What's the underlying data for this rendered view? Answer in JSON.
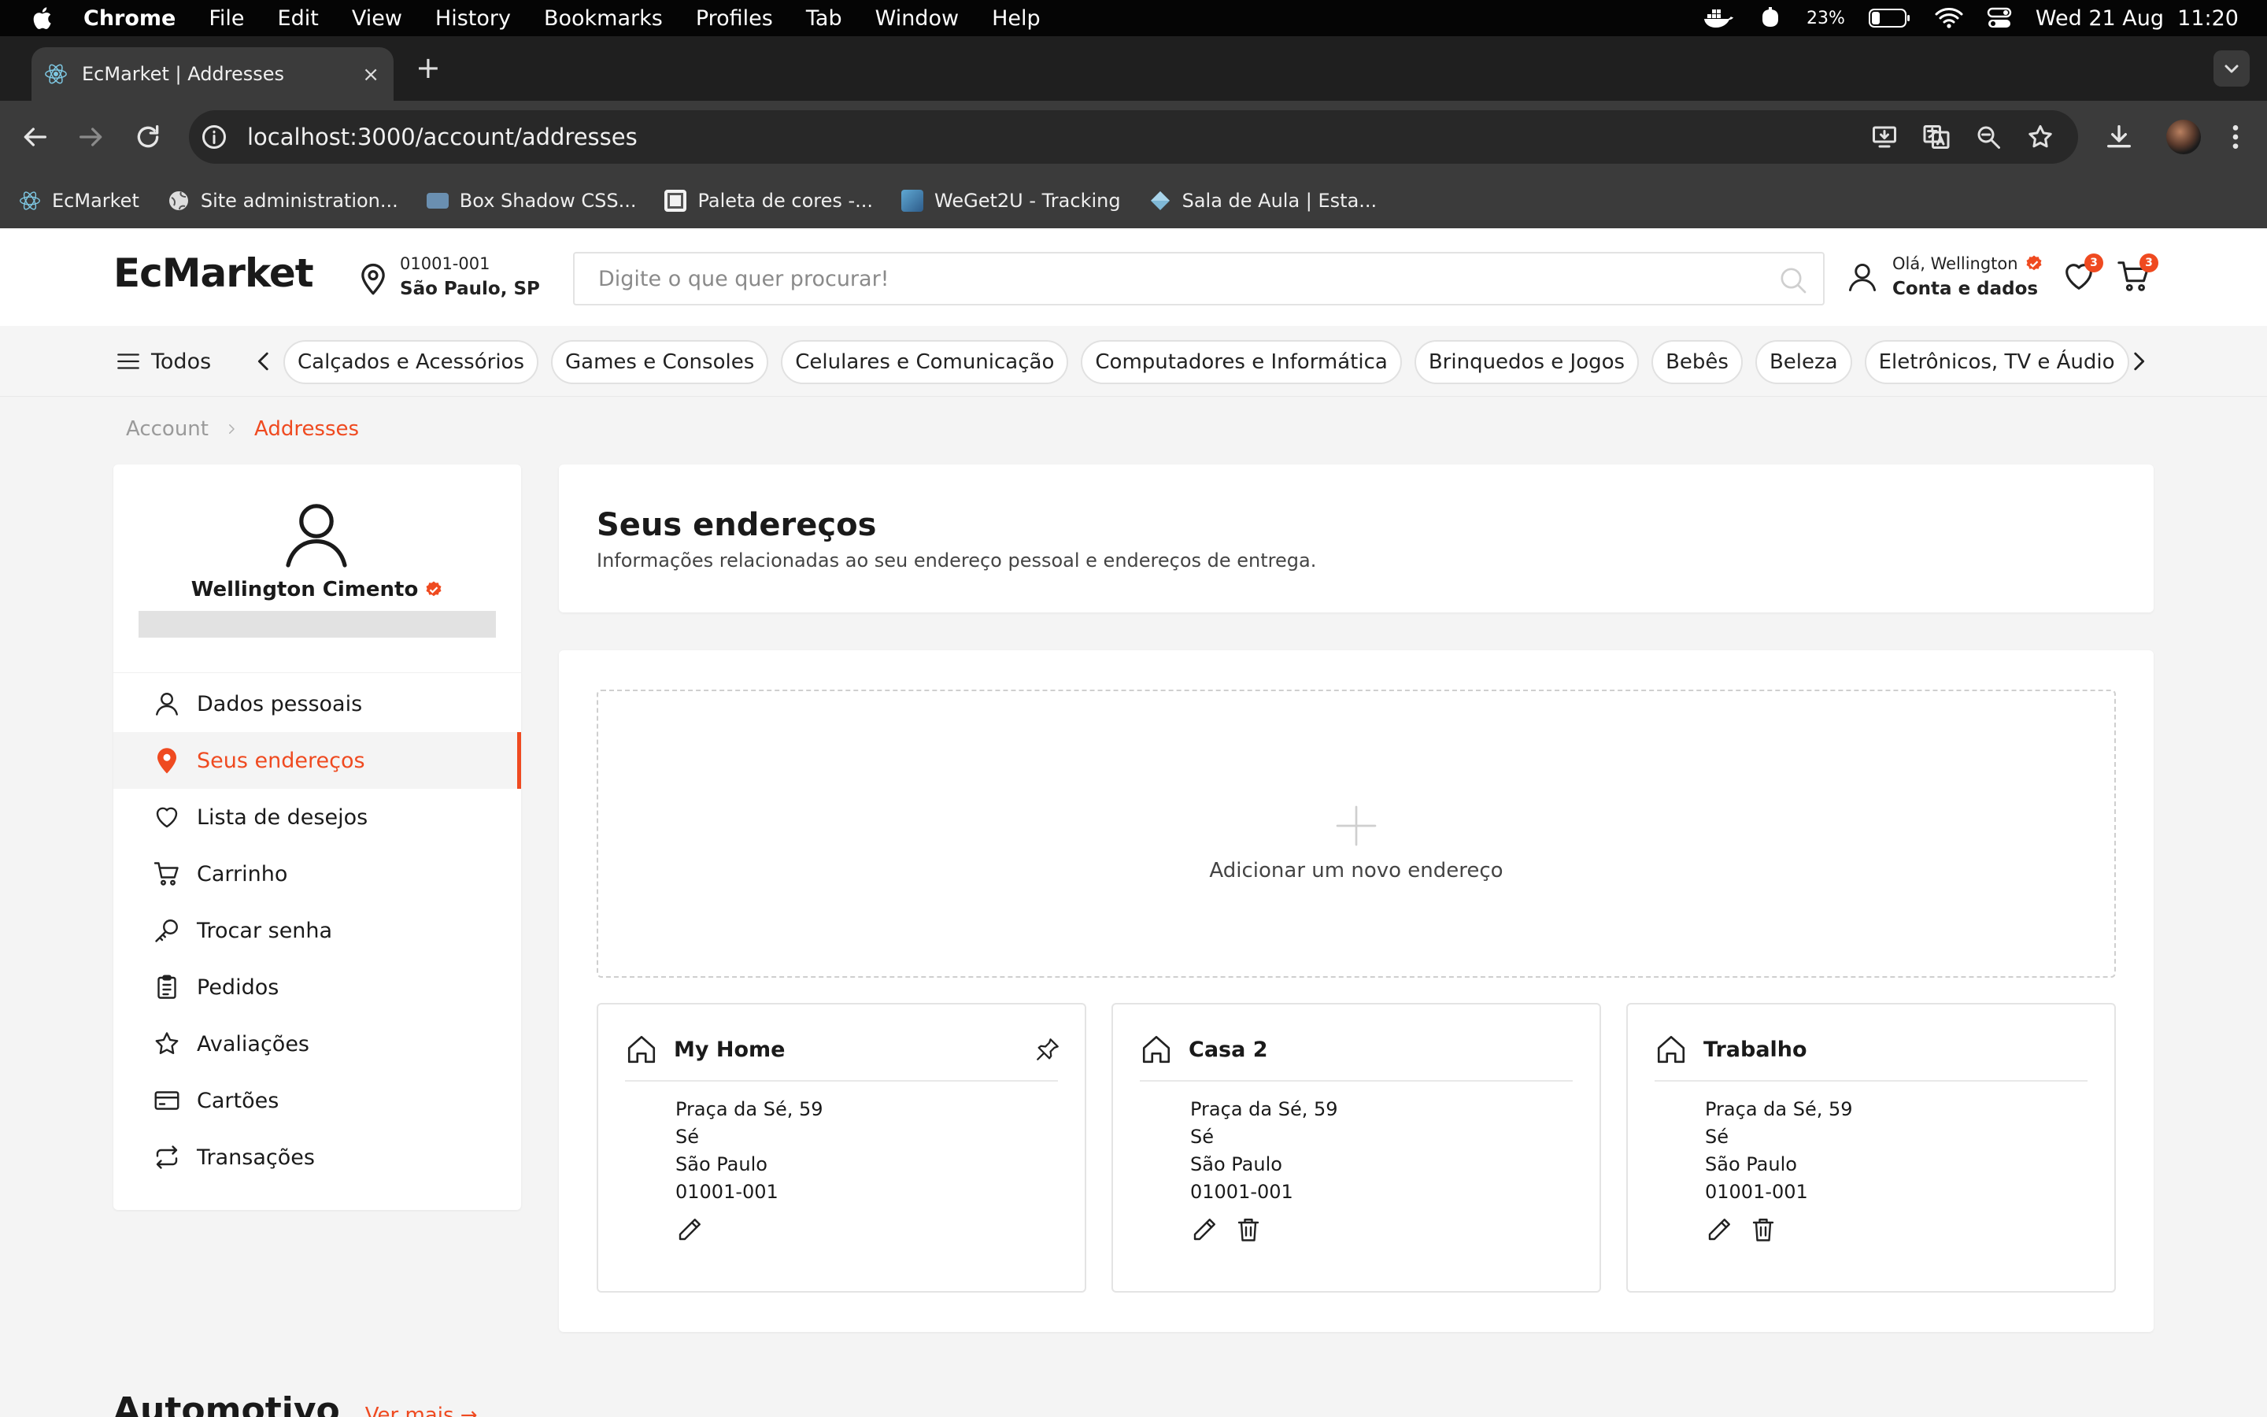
{
  "menubar": {
    "app": "Chrome",
    "items": [
      "File",
      "Edit",
      "View",
      "History",
      "Bookmarks",
      "Profiles",
      "Tab",
      "Window",
      "Help"
    ],
    "battery": "23%",
    "datetime": "Wed 21 Aug  11:20"
  },
  "browser": {
    "tab_title": "EcMarket | Addresses",
    "new_tab": "+",
    "close": "×",
    "url": "localhost:3000/account/addresses",
    "bookmarks": [
      {
        "label": "EcMarket",
        "icon": "react-icon"
      },
      {
        "label": "Site administration...",
        "icon": "globe-icon"
      },
      {
        "label": "Box Shadow CSS...",
        "icon": "box-shadow-icon"
      },
      {
        "label": "Paleta de cores -...",
        "icon": "palette-icon"
      },
      {
        "label": "WeGet2U - Tracking",
        "icon": "tracking-icon"
      },
      {
        "label": "Sala de Aula | Esta...",
        "icon": "diamond-icon"
      }
    ]
  },
  "header": {
    "logo": "EcMarket",
    "location_line1": "01001-001",
    "location_line2": "São Paulo, SP",
    "search_placeholder": "Digite o que quer procurar!",
    "greeting": "Olá, Wellington",
    "account_link": "Conta e dados",
    "wishlist_count": "3",
    "cart_count": "3"
  },
  "categories": {
    "all_label": "Todos",
    "items": [
      "Calçados e Acessórios",
      "Games e Consoles",
      "Celulares e Comunicação",
      "Computadores e Informática",
      "Brinquedos e Jogos",
      "Bebês",
      "Beleza",
      "Eletrônicos, TV e Áudio"
    ]
  },
  "breadcrumb": {
    "parent": "Account",
    "current": "Addresses"
  },
  "sidebar": {
    "user_name": "Wellington Cimento",
    "nav": [
      {
        "label": "Dados pessoais",
        "icon": "user-icon",
        "active": false
      },
      {
        "label": "Seus endereços",
        "icon": "location-pin-icon",
        "active": true
      },
      {
        "label": "Lista de desejos",
        "icon": "heart-icon",
        "active": false
      },
      {
        "label": "Carrinho",
        "icon": "cart-icon",
        "active": false
      },
      {
        "label": "Trocar senha",
        "icon": "key-icon",
        "active": false
      },
      {
        "label": "Pedidos",
        "icon": "clipboard-icon",
        "active": false
      },
      {
        "label": "Avaliações",
        "icon": "star-icon",
        "active": false
      },
      {
        "label": "Cartões",
        "icon": "card-icon",
        "active": false
      },
      {
        "label": "Transações",
        "icon": "transactions-icon",
        "active": false
      }
    ]
  },
  "main": {
    "title": "Seus endereços",
    "subtitle": "Informações relacionadas ao seu endereço pessoal e endereços de entrega.",
    "add_label": "Adicionar um novo endereço",
    "addresses": [
      {
        "name": "My Home",
        "street": "Praça da Sé, 59",
        "district": "Sé",
        "city": "São Paulo",
        "zip": "01001-001",
        "pinned": true,
        "deletable": false
      },
      {
        "name": "Casa 2",
        "street": "Praça da Sé, 59",
        "district": "Sé",
        "city": "São Paulo",
        "zip": "01001-001",
        "pinned": false,
        "deletable": true
      },
      {
        "name": "Trabalho",
        "street": "Praça da Sé, 59",
        "district": "Sé",
        "city": "São Paulo",
        "zip": "01001-001",
        "pinned": false,
        "deletable": true
      }
    ]
  },
  "section": {
    "title": "Automotivo",
    "link": "Ver mais →"
  },
  "colors": {
    "accent": "#ef4a20",
    "background": "#f4f4f4"
  }
}
